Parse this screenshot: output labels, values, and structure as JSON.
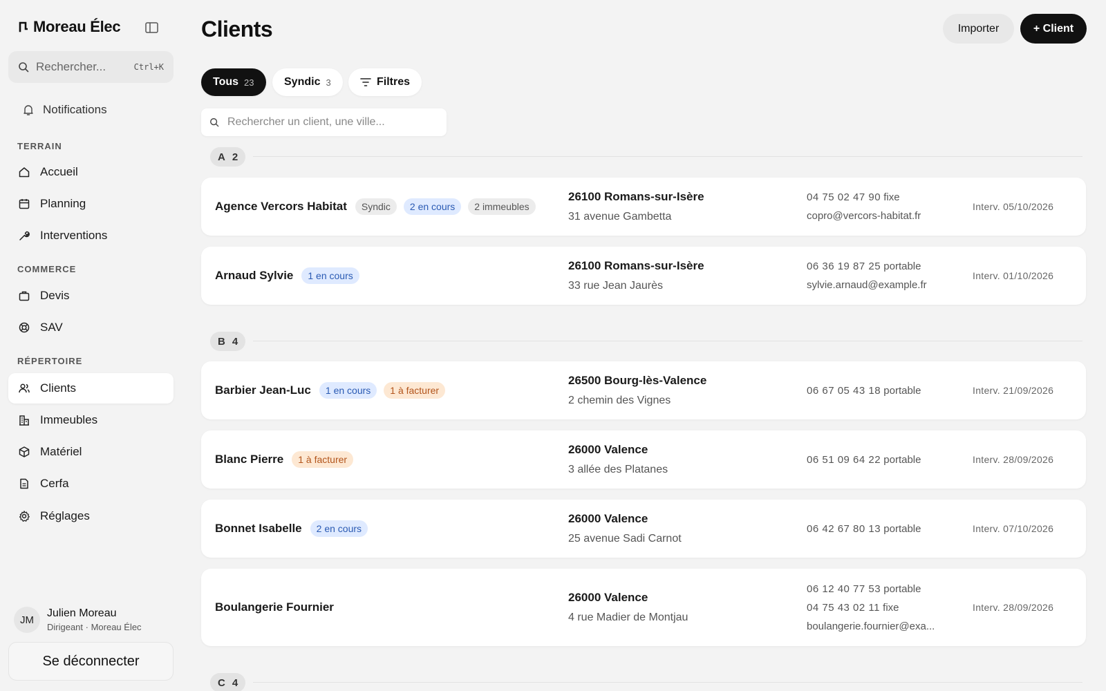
{
  "app": {
    "brand": "Moreau Élec",
    "search_placeholder": "Rechercher...",
    "search_shortcut": "Ctrl+K",
    "notifications_label": "Notifications"
  },
  "sidebar": {
    "sections": {
      "terrain": "TERRAIN",
      "commerce": "COMMERCE",
      "repertoire": "RÉPERTOIRE"
    },
    "items": {
      "accueil": "Accueil",
      "planning": "Planning",
      "interventions": "Interventions",
      "devis": "Devis",
      "sav": "SAV",
      "clients": "Clients",
      "immeubles": "Immeubles",
      "materiel": "Matériel",
      "cerfa": "Cerfa",
      "reglages": "Réglages"
    },
    "active": "clients",
    "user": {
      "initials": "JM",
      "name": "Julien Moreau",
      "role": "Dirigeant · Moreau Élec"
    },
    "logout_label": "Se déconnecter"
  },
  "header": {
    "title": "Clients",
    "import_label": "Importer",
    "new_client_label": "+ Client"
  },
  "filters": {
    "chips": [
      {
        "label": "Tous",
        "count": "23"
      },
      {
        "label": "Syndic",
        "count": "3"
      }
    ],
    "filters_label": "Filtres",
    "search_placeholder": "Rechercher un client, une ville..."
  },
  "groups": [
    {
      "letter": "A",
      "count": "2"
    },
    {
      "letter": "B",
      "count": "4"
    },
    {
      "letter": "C",
      "count": "4"
    }
  ],
  "clients": [
    {
      "name": "Agence Vercors Habitat",
      "badges": [
        {
          "text": "Syndic",
          "tone": "gray"
        },
        {
          "text": "2 en cours",
          "tone": "blue"
        },
        {
          "text": "2 immeubles",
          "tone": "gray"
        }
      ],
      "city": "26100 Romans-sur-Isère",
      "street": "31 avenue Gambetta",
      "contacts": [
        {
          "phone": "04 75 02 47 90",
          "kind": "fixe"
        },
        {
          "email": "copro@vercors-habitat.fr"
        }
      ],
      "interv": "Interv. 05/10/2026"
    },
    {
      "name": "Arnaud Sylvie",
      "badges": [
        {
          "text": "1 en cours",
          "tone": "blue"
        }
      ],
      "city": "26100 Romans-sur-Isère",
      "street": "33 rue Jean Jaurès",
      "contacts": [
        {
          "phone": "06 36 19 87 25",
          "kind": "portable"
        },
        {
          "email": "sylvie.arnaud@example.fr"
        }
      ],
      "interv": "Interv. 01/10/2026"
    },
    {
      "name": "Barbier Jean-Luc",
      "badges": [
        {
          "text": "1 en cours",
          "tone": "blue"
        },
        {
          "text": "1 à facturer",
          "tone": "orange"
        }
      ],
      "city": "26500 Bourg-lès-Valence",
      "street": "2 chemin des Vignes",
      "contacts": [
        {
          "phone": "06 67 05 43 18",
          "kind": "portable"
        }
      ],
      "interv": "Interv. 21/09/2026"
    },
    {
      "name": "Blanc Pierre",
      "badges": [
        {
          "text": "1 à facturer",
          "tone": "orange"
        }
      ],
      "city": "26000 Valence",
      "street": "3 allée des Platanes",
      "contacts": [
        {
          "phone": "06 51 09 64 22",
          "kind": "portable"
        }
      ],
      "interv": "Interv. 28/09/2026"
    },
    {
      "name": "Bonnet Isabelle",
      "badges": [
        {
          "text": "2 en cours",
          "tone": "blue"
        }
      ],
      "city": "26000 Valence",
      "street": "25 avenue Sadi Carnot",
      "contacts": [
        {
          "phone": "06 42 67 80 13",
          "kind": "portable"
        }
      ],
      "interv": "Interv. 07/10/2026"
    },
    {
      "name": "Boulangerie Fournier",
      "badges": [],
      "city": "26000 Valence",
      "street": "4 rue Madier de Montjau",
      "contacts": [
        {
          "phone": "06 12 40 77 53",
          "kind": "portable"
        },
        {
          "phone": "04 75 43 02 11",
          "kind": "fixe"
        },
        {
          "email": "boulangerie.fournier@exa..."
        }
      ],
      "interv": "Interv. 28/09/2026"
    }
  ],
  "colors": {
    "background": "#f3f3f3",
    "primary": "#111111",
    "badge_blue": "#2a5ab3",
    "badge_orange": "#b2541b"
  }
}
